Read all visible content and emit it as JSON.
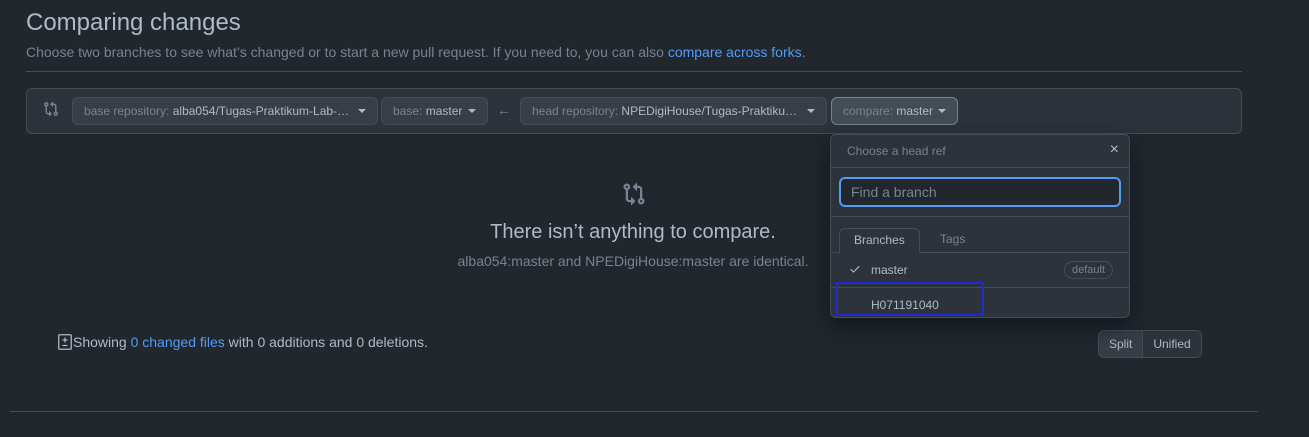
{
  "page": {
    "title": "Comparing changes",
    "subtitle_text": "Choose two branches to see what’s changed or to start a new pull request. If you need to, you can also",
    "subtitle_link": "compare across forks",
    "subtitle_end": "."
  },
  "range": {
    "base_repo_label": "base repository:",
    "base_repo_value": "alba054/Tugas-Praktikum-Lab-…",
    "base_label": "base:",
    "base_value": "master",
    "head_repo_label": "head repository:",
    "head_repo_value": "NPEDigiHouse/Tugas-Praktiku…",
    "compare_label": "compare:",
    "compare_value": "master",
    "arrow": "←"
  },
  "blankslate": {
    "title": "There isn’t anything to compare.",
    "subtitle": "alba054:master and NPEDigiHouse:master are identical."
  },
  "summary": {
    "prefix": "Showing",
    "link": "0 changed files",
    "suffix": "with 0 additions and 0 deletions."
  },
  "view_toggle": {
    "split": "Split",
    "unified": "Unified"
  },
  "ref_menu": {
    "title": "Choose a head ref",
    "close": "×",
    "filter_placeholder": "Find a branch",
    "tabs": {
      "branches": "Branches",
      "tags": "Tags"
    },
    "items": [
      {
        "name": "master",
        "selected": true,
        "badge": "default"
      },
      {
        "name": "H071191040",
        "selected": false,
        "badge": ""
      }
    ]
  },
  "colors": {
    "background": "#22272e",
    "link": "#539bf5",
    "highlight_box": "#1f2bd0"
  },
  "icons": [
    "git-compare-icon",
    "arrow-left-icon",
    "caret-down-icon",
    "diff-icon",
    "check-icon",
    "close-icon"
  ]
}
